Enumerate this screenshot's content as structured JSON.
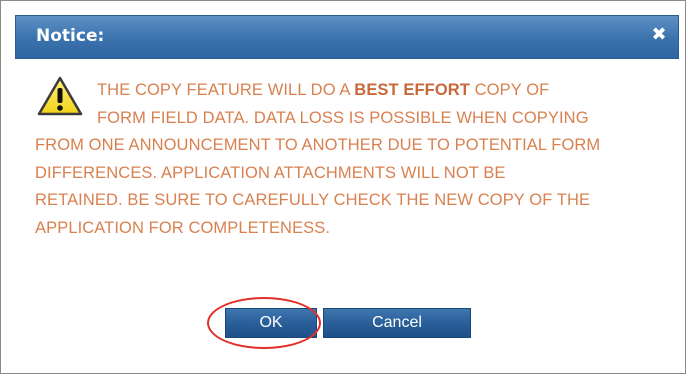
{
  "dialog": {
    "title": "Notice:",
    "close_symbol": "✖",
    "icon": "warning-icon",
    "message_lines": [
      {
        "before": "THE COPY FEATURE WILL DO A ",
        "bold": "BEST EFFORT",
        "after": " COPY OF"
      },
      {
        "text": "FORM FIELD DATA. DATA LOSS IS POSSIBLE WHEN COPYING"
      },
      {
        "text": "FROM ONE ANNOUNCEMENT TO ANOTHER DUE TO POTENTIAL FORM"
      },
      {
        "text": "DIFFERENCES. APPLICATION ATTACHMENTS WILL NOT BE"
      },
      {
        "text": "RETAINED. BE SURE TO CAREFULLY CHECK THE NEW COPY OF THE"
      },
      {
        "text": "APPLICATION FOR COMPLETENESS."
      }
    ],
    "buttons": {
      "ok_label": "OK",
      "cancel_label": "Cancel"
    }
  },
  "colors": {
    "titlebar": "#3a72ad",
    "message_text": "#d9804f",
    "button": "#2a5f99",
    "highlight_ring": "#e0302a"
  }
}
